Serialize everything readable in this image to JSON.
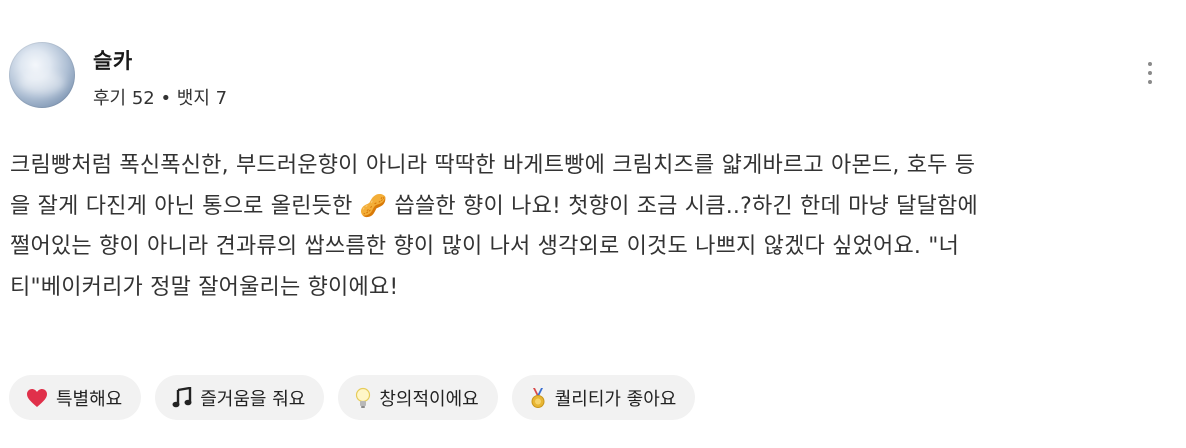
{
  "user": {
    "name": "슬카",
    "meta": "후기 52 • 뱃지 7"
  },
  "review": {
    "lines": [
      "크림빵처럼 폭신폭신한, 부드러운향이 아니라 딱딱한 바게트빵에 크림치즈를 얇게바르고 아몬드, 호두 등",
      "을 잘게 다진게 아닌 통으로 올린듯한 🥜 씁쓸한 향이 나요! 첫향이 조금 시큼..?하긴 한데 마냥 달달함에",
      "쩔어있는 향이 아니라 견과류의 쌉쓰름한 향이 많이 나서 생각외로 이것도 나쁘지 않겠다 싶었어요. \"너",
      "티\"베이커리가 정말 잘어울리는 향이에요!"
    ]
  },
  "reactions": [
    {
      "icon": "heart-icon",
      "label": "특별해요"
    },
    {
      "icon": "music-note-icon",
      "label": "즐거움을 줘요"
    },
    {
      "icon": "lightbulb-icon",
      "label": "창의적이에요"
    },
    {
      "icon": "medal-icon",
      "label": "퀄리티가 좋아요"
    }
  ],
  "colors": {
    "chip_bg": "#f2f2f2",
    "heart": "#e0304a",
    "medal_gold": "#e8b634",
    "medal_ribbon": "#d94a4a"
  }
}
